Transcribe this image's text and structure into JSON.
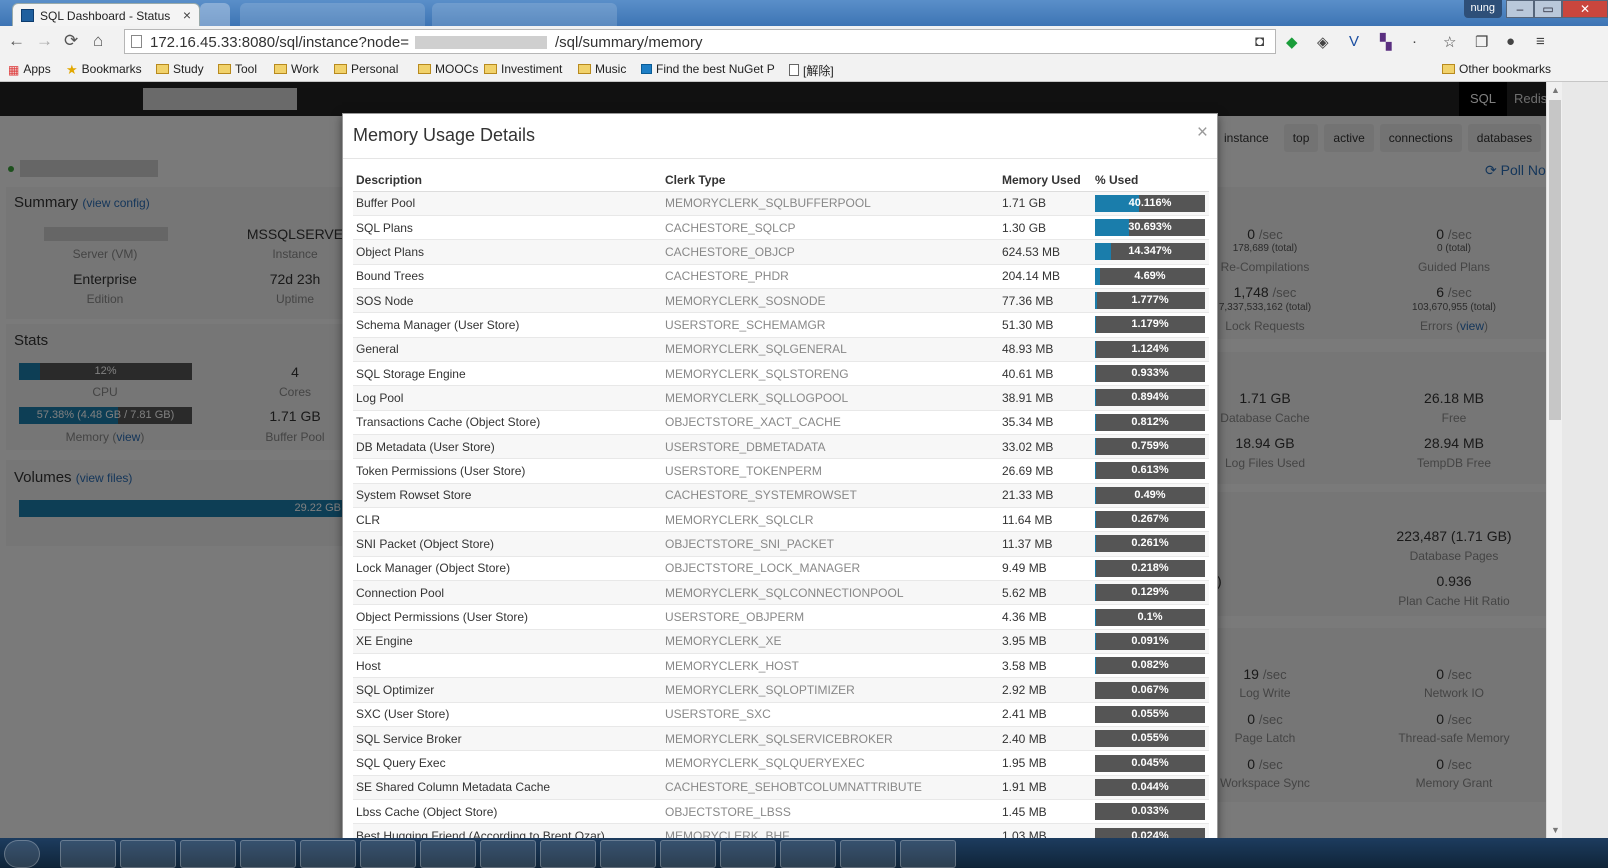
{
  "browser": {
    "tab_title": "SQL Dashboard - Status",
    "tab_close": "×",
    "url_prefix": "172.16.45.33:8080/sql/instance?node=",
    "url_suffix": "/sql/summary/memory",
    "user_badge": "nung",
    "bookmarks": [
      {
        "label": "Apps",
        "icon": "apps-icon"
      },
      {
        "label": "Bookmarks",
        "icon": "star-icon"
      },
      {
        "label": "Study",
        "icon": "folder-icon"
      },
      {
        "label": "Tool",
        "icon": "folder-icon"
      },
      {
        "label": "Work",
        "icon": "folder-icon"
      },
      {
        "label": "Personal",
        "icon": "folder-icon"
      },
      {
        "label": "MOOCs",
        "icon": "folder-icon"
      },
      {
        "label": "Investiment",
        "icon": "folder-icon"
      },
      {
        "label": "Music",
        "icon": "folder-icon"
      },
      {
        "label": "Find the best NuGet P",
        "icon": "nuget-icon"
      },
      {
        "label": "[解除]",
        "icon": "page-icon"
      }
    ],
    "other_bookmarks": "Other bookmarks"
  },
  "nav": {
    "sql": "SQL",
    "redis": "Redis"
  },
  "subtabs": [
    "instance",
    "top",
    "active",
    "connections",
    "databases"
  ],
  "poll_now": "Poll No",
  "summary": {
    "title": "Summary",
    "view_config": "view config",
    "instance_value": "MSSQLSERVE",
    "server_label": "Server (VM)",
    "instance_label": "Instance",
    "edition_value": "Enterprise",
    "edition_label": "Edition",
    "uptime_value": "72d 23h",
    "uptime_label": "Uptime"
  },
  "stats": {
    "title": "Stats",
    "cpu_pct": 12,
    "cpu_text": "12%",
    "cpu_label": "CPU",
    "cores_value": "4",
    "cores_label": "Cores",
    "memory_pct": 57.38,
    "memory_text_a": "57.38% (4.48 GB",
    "memory_text_b": " / 7.81 GB)",
    "memory_label": "Memory",
    "memory_view": "view",
    "buffer_pool_value": "1.71 GB",
    "buffer_pool_label": "Buffer Pool"
  },
  "volumes": {
    "title": "Volumes",
    "view_files": "view files",
    "bar_text": "29.22 GB"
  },
  "right_stats": {
    "recompile_value": "0",
    "recompile_unit": "/sec",
    "recompile_total": "178,689 (total)",
    "recompile_label": "Re-Compilations",
    "guided_value": "0",
    "guided_unit": "/sec",
    "guided_total": "0 (total)",
    "guided_label": "Guided Plans",
    "lock_value": "1,748",
    "lock_unit": "/sec",
    "lock_total": "7,337,533,162 (total)",
    "lock_label": "Lock Requests",
    "errors_value": "6",
    "errors_unit": "/sec",
    "errors_total": "103,670,955 (total)",
    "errors_label": "Errors",
    "errors_view": "view",
    "dbcache_value": "1.71 GB",
    "dbcache_label": "Database Cache",
    "free_value": "26.18 MB",
    "free_label": "Free",
    "logfiles_value": "18.94 GB",
    "logfiles_label": "Log Files Used",
    "tempdb_value": "28.94 MB",
    "tempdb_label": "TempDB Free",
    "dbpages_value": "223,487 (1.71 GB)",
    "dbpages_label": "Database Pages",
    "paren": ")",
    "plancache_value": "0.936",
    "plancache_label": "Plan Cache Hit Ratio",
    "logwrite_value": "19",
    "logwrite_unit": "/sec",
    "logwrite_label": "Log Write",
    "netio_value": "0",
    "netio_unit": "/sec",
    "netio_label": "Network IO",
    "pagelatch_value": "0",
    "pagelatch_unit": "/sec",
    "pagelatch_label": "Page Latch",
    "threadsafe_value": "0",
    "threadsafe_unit": "/sec",
    "threadsafe_label": "Thread-safe Memory",
    "workspace_value": "0",
    "workspace_unit": "/sec",
    "workspace_label": "Workspace Sync",
    "memgrant_value": "0",
    "memgrant_unit": "/sec",
    "memgrant_label": "Memory Grant"
  },
  "modal": {
    "title": "Memory Usage Details",
    "close": "×",
    "columns": [
      "Description",
      "Clerk Type",
      "Memory Used",
      "% Used"
    ],
    "rows": [
      {
        "description": "Buffer Pool",
        "clerk": "MEMORYCLERK_SQLBUFFERPOOL",
        "used": "1.71 GB",
        "pct_text": "40.116%",
        "pct": 40.116
      },
      {
        "description": "SQL Plans",
        "clerk": "CACHESTORE_SQLCP",
        "used": "1.30 GB",
        "pct_text": "30.693%",
        "pct": 30.693
      },
      {
        "description": "Object Plans",
        "clerk": "CACHESTORE_OBJCP",
        "used": "624.53 MB",
        "pct_text": "14.347%",
        "pct": 14.347
      },
      {
        "description": "Bound Trees",
        "clerk": "CACHESTORE_PHDR",
        "used": "204.14 MB",
        "pct_text": "4.69%",
        "pct": 4.69
      },
      {
        "description": "SOS Node",
        "clerk": "MEMORYCLERK_SOSNODE",
        "used": "77.36 MB",
        "pct_text": "1.777%",
        "pct": 1.777
      },
      {
        "description": "Schema Manager (User Store)",
        "clerk": "USERSTORE_SCHEMAMGR",
        "used": "51.30 MB",
        "pct_text": "1.179%",
        "pct": 1.179
      },
      {
        "description": "General",
        "clerk": "MEMORYCLERK_SQLGENERAL",
        "used": "48.93 MB",
        "pct_text": "1.124%",
        "pct": 1.124
      },
      {
        "description": "SQL Storage Engine",
        "clerk": "MEMORYCLERK_SQLSTORENG",
        "used": "40.61 MB",
        "pct_text": "0.933%",
        "pct": 0.933
      },
      {
        "description": "Log Pool",
        "clerk": "MEMORYCLERK_SQLLOGPOOL",
        "used": "38.91 MB",
        "pct_text": "0.894%",
        "pct": 0.894
      },
      {
        "description": "Transactions Cache (Object Store)",
        "clerk": "OBJECTSTORE_XACT_CACHE",
        "used": "35.34 MB",
        "pct_text": "0.812%",
        "pct": 0.812
      },
      {
        "description": "DB Metadata (User Store)",
        "clerk": "USERSTORE_DBMETADATA",
        "used": "33.02 MB",
        "pct_text": "0.759%",
        "pct": 0.759
      },
      {
        "description": "Token Permissions (User Store)",
        "clerk": "USERSTORE_TOKENPERM",
        "used": "26.69 MB",
        "pct_text": "0.613%",
        "pct": 0.613
      },
      {
        "description": "System Rowset Store",
        "clerk": "CACHESTORE_SYSTEMROWSET",
        "used": "21.33 MB",
        "pct_text": "0.49%",
        "pct": 0.49
      },
      {
        "description": "CLR",
        "clerk": "MEMORYCLERK_SQLCLR",
        "used": "11.64 MB",
        "pct_text": "0.267%",
        "pct": 0.267
      },
      {
        "description": "SNI Packet (Object Store)",
        "clerk": "OBJECTSTORE_SNI_PACKET",
        "used": "11.37 MB",
        "pct_text": "0.261%",
        "pct": 0.261
      },
      {
        "description": "Lock Manager (Object Store)",
        "clerk": "OBJECTSTORE_LOCK_MANAGER",
        "used": "9.49 MB",
        "pct_text": "0.218%",
        "pct": 0.218
      },
      {
        "description": "Connection Pool",
        "clerk": "MEMORYCLERK_SQLCONNECTIONPOOL",
        "used": "5.62 MB",
        "pct_text": "0.129%",
        "pct": 0.129
      },
      {
        "description": "Object Permissions (User Store)",
        "clerk": "USERSTORE_OBJPERM",
        "used": "4.36 MB",
        "pct_text": "0.1%",
        "pct": 0.1
      },
      {
        "description": "XE Engine",
        "clerk": "MEMORYCLERK_XE",
        "used": "3.95 MB",
        "pct_text": "0.091%",
        "pct": 0.091
      },
      {
        "description": "Host",
        "clerk": "MEMORYCLERK_HOST",
        "used": "3.58 MB",
        "pct_text": "0.082%",
        "pct": 0.082
      },
      {
        "description": "SQL Optimizer",
        "clerk": "MEMORYCLERK_SQLOPTIMIZER",
        "used": "2.92 MB",
        "pct_text": "0.067%",
        "pct": 0.067
      },
      {
        "description": "SXC (User Store)",
        "clerk": "USERSTORE_SXC",
        "used": "2.41 MB",
        "pct_text": "0.055%",
        "pct": 0.055
      },
      {
        "description": "SQL Service Broker",
        "clerk": "MEMORYCLERK_SQLSERVICEBROKER",
        "used": "2.40 MB",
        "pct_text": "0.055%",
        "pct": 0.055
      },
      {
        "description": "SQL Query Exec",
        "clerk": "MEMORYCLERK_SQLQUERYEXEC",
        "used": "1.95 MB",
        "pct_text": "0.045%",
        "pct": 0.045
      },
      {
        "description": "SE Shared Column Metadata Cache",
        "clerk": "CACHESTORE_SEHOBTCOLUMNATTRIBUTE",
        "used": "1.91 MB",
        "pct_text": "0.044%",
        "pct": 0.044
      },
      {
        "description": "Lbss Cache (Object Store)",
        "clerk": "OBJECTSTORE_LBSS",
        "used": "1.45 MB",
        "pct_text": "0.033%",
        "pct": 0.033
      },
      {
        "description": "Best Hugging Friend (According to Brent Ozar)",
        "clerk": "MEMORYCLERK_BHF",
        "used": "1.03 MB",
        "pct_text": "0.024%",
        "pct": 0.024
      }
    ]
  },
  "colors": {
    "accent": "#1a7dab",
    "bar_bg": "#555555",
    "nav_bg": "#222222"
  }
}
